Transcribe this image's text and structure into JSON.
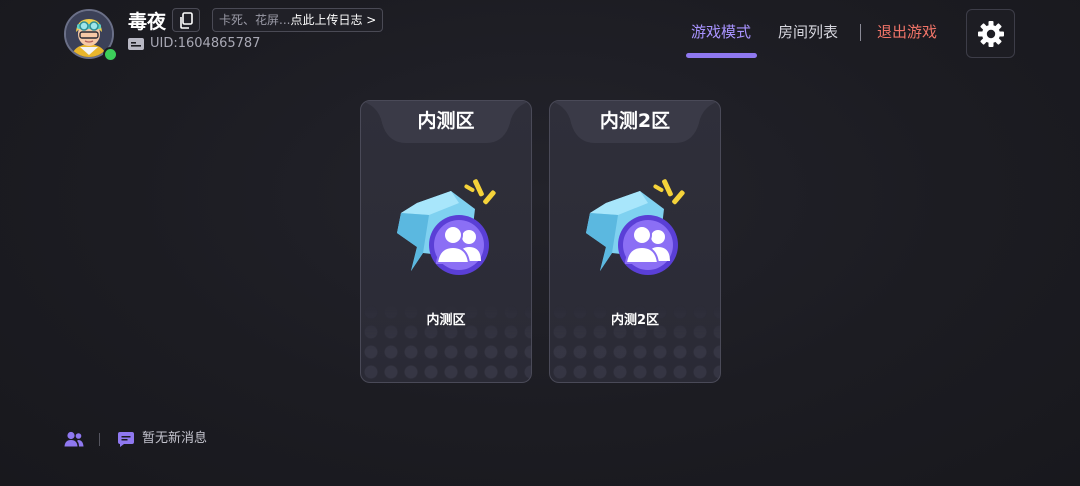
{
  "profile": {
    "username": "毒夜",
    "uid_text": "UID:1604865787",
    "upload_log_hint": "卡死、花屏...",
    "upload_log_action": "点此上传日志 >",
    "status": "online"
  },
  "nav": {
    "tabs": [
      {
        "label": "游戏模式",
        "active": true
      },
      {
        "label": "房间列表",
        "active": false
      }
    ],
    "exit_label": "退出游戏",
    "active_color": "#a893ff",
    "exit_color": "#f07468"
  },
  "zones": [
    {
      "title": "内测区",
      "label": "内测区",
      "icon": "group-chat-icon"
    },
    {
      "title": "内测2区",
      "label": "内测2区",
      "icon": "group-chat-icon"
    }
  ],
  "footer": {
    "message_text": "暂无新消息"
  },
  "colors": {
    "accent": "#8f78f0",
    "exit": "#f07468",
    "online": "#3ccf5a",
    "background": "#1c1c22"
  }
}
